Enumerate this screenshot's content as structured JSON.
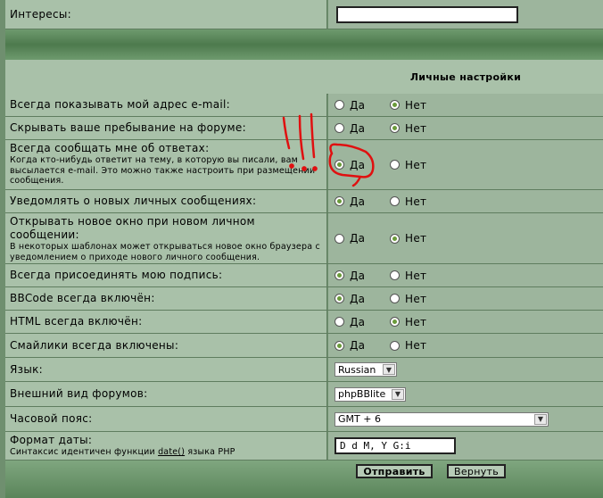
{
  "interests": {
    "label": "Интересы:",
    "value": ""
  },
  "section_title": "Личные настройки",
  "radio_labels": {
    "yes": "Да",
    "no": "Нет"
  },
  "settings": [
    {
      "label": "Всегда показывать мой адрес e-mail:",
      "hint": "",
      "value": "no"
    },
    {
      "label": "Скрывать ваше пребывание на форуме:",
      "hint": "",
      "value": "no"
    },
    {
      "label": "Всегда сообщать мне об ответах:",
      "hint": "Когда кто-нибудь ответит на тему, в которую вы писали, вам высылается e-mail. Это можно также настроить при размещении сообщения.",
      "value": "yes"
    },
    {
      "label": "Уведомлять о новых личных сообщениях:",
      "hint": "",
      "value": "yes"
    },
    {
      "label": "Открывать новое окно при новом личном сообщении:",
      "hint": "В некоторых шаблонах может открываться новое окно браузера с уведомлением о приходе нового личного сообщения.",
      "value": "no"
    },
    {
      "label": "Всегда присоединять мою подпись:",
      "hint": "",
      "value": "yes"
    },
    {
      "label": "BBCode всегда включён:",
      "hint": "",
      "value": "yes"
    },
    {
      "label": "HTML всегда включён:",
      "hint": "",
      "value": "no"
    },
    {
      "label": "Смайлики всегда включены:",
      "hint": "",
      "value": "yes"
    }
  ],
  "language": {
    "label": "Язык:",
    "value": "Russian"
  },
  "style": {
    "label": "Внешний вид форумов:",
    "value": "phpBBlite"
  },
  "timezone": {
    "label": "Часовой пояс:",
    "value": "GMT + 6"
  },
  "date_format": {
    "label": "Формат даты:",
    "hint_prefix": "Синтаксис идентичен функции ",
    "hint_link": "date()",
    "hint_suffix": " языка PHP",
    "value": "D d M, Y G:i"
  },
  "buttons": {
    "submit": "Отправить",
    "reset": "Вернуть"
  },
  "annotation": {
    "mark": "!!!",
    "color": "#e01010"
  }
}
